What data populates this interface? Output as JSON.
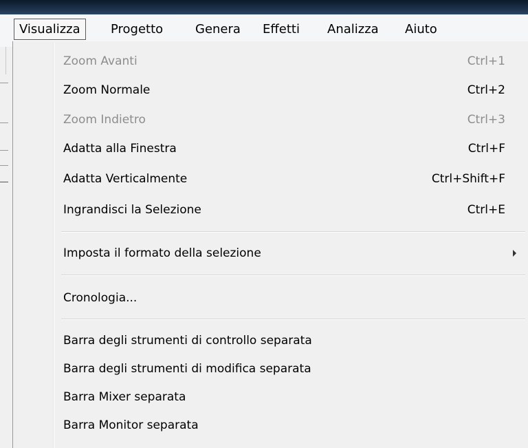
{
  "menubar": {
    "items": [
      {
        "label": "Visualizza",
        "active": true
      },
      {
        "label": "Progetto"
      },
      {
        "label": "Genera"
      },
      {
        "label": "Effetti"
      },
      {
        "label": "Analizza"
      },
      {
        "label": "Aiuto"
      }
    ]
  },
  "menu": {
    "items": [
      {
        "label": "Zoom Avanti",
        "shortcut": "Ctrl+1",
        "enabled": false
      },
      {
        "label": "Zoom Normale",
        "shortcut": "Ctrl+2",
        "enabled": true
      },
      {
        "label": "Zoom Indietro",
        "shortcut": "Ctrl+3",
        "enabled": false
      },
      {
        "label": "Adatta alla Finestra",
        "shortcut": "Ctrl+F",
        "enabled": true
      },
      {
        "label": "Adatta Verticalmente",
        "shortcut": "Ctrl+Shift+F",
        "enabled": true
      },
      {
        "label": "Ingrandisci la Selezione",
        "shortcut": "Ctrl+E",
        "enabled": true
      },
      {
        "label": "Imposta il formato della selezione",
        "shortcut": "",
        "enabled": true,
        "submenu": true
      },
      {
        "label": "Cronologia...",
        "shortcut": "",
        "enabled": true
      },
      {
        "label": "Barra degli strumenti di controllo separata",
        "shortcut": "",
        "enabled": true
      },
      {
        "label": "Barra degli strumenti di modifica separata",
        "shortcut": "",
        "enabled": true
      },
      {
        "label": "Barra Mixer separata",
        "shortcut": "",
        "enabled": true
      },
      {
        "label": "Barra Monitor separata",
        "shortcut": "",
        "enabled": true
      }
    ]
  },
  "icons": {
    "submenu_arrow": "chevron-right-icon"
  }
}
